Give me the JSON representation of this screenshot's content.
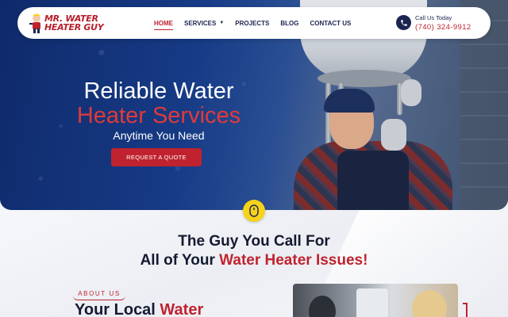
{
  "brand": {
    "logo_line1": "MR. WATER",
    "logo_line2": "HEATER GUY"
  },
  "nav": {
    "items": [
      {
        "label": "HOME",
        "active": true
      },
      {
        "label": "SERVICES",
        "has_dropdown": true
      },
      {
        "label": "PROJECTS"
      },
      {
        "label": "BLOG"
      },
      {
        "label": "CONTACT US"
      }
    ]
  },
  "call": {
    "label": "Call Us Today",
    "number": "(740) 324-9912",
    "icon": "phone-icon"
  },
  "hero": {
    "line1": "Reliable Water",
    "line2": "Heater Services",
    "subtitle": "Anytime You Need",
    "cta": "REQUEST A QUOTE"
  },
  "section2": {
    "title_line1": "The Guy You Call For",
    "title_line2_prefix": "All of Your ",
    "title_line2_highlight": "Water Heater Issues!",
    "about_tag": "ABOUT US",
    "about_title_prefix": "Your Local ",
    "about_title_highlight": "Water"
  },
  "colors": {
    "accent_red": "#c0232f",
    "navy": "#1b2550",
    "scroll_yellow": "#f6d21b"
  }
}
